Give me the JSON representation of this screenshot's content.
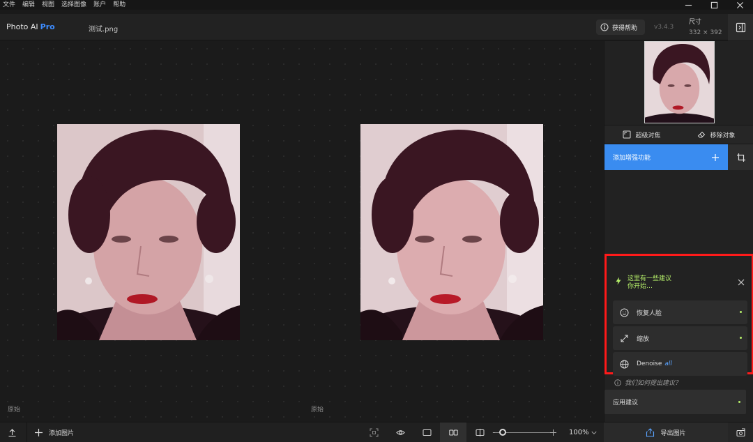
{
  "menubar": {
    "items": [
      "文件",
      "编辑",
      "视图",
      "选择图像",
      "账户",
      "帮助"
    ]
  },
  "header": {
    "app_name": "Photo AI",
    "app_tier": "Pro",
    "filename": "测试.png",
    "help_label": "获得帮助",
    "version": "v3.4.3",
    "size_label": "尺寸",
    "size_value": "332 × 392"
  },
  "canvas": {
    "left_label": "原始",
    "right_label": "原始"
  },
  "sidebar": {
    "tools": {
      "refocus": "超级对焦",
      "remove": "移除对象"
    },
    "enhance_label": "添加增强功能",
    "suggestions": {
      "line1": "这里有一些建议",
      "line2": "你开始…",
      "items": [
        {
          "label": "恢复人脸",
          "tag": ""
        },
        {
          "label": "缩放",
          "tag": ""
        },
        {
          "label": "Denoise",
          "tag": "all"
        }
      ]
    },
    "how_label": "我们如何提出建议？",
    "apply_label": "应用建议"
  },
  "bottombar": {
    "add_image_label": "添加图片",
    "zoom_value": "100%",
    "zoom_level": 0.14,
    "export_label": "导出图片"
  },
  "colors": {
    "accent": "#3a8cf0",
    "suggest_green": "#b6f06a",
    "highlight_red": "#ff1a1a"
  }
}
